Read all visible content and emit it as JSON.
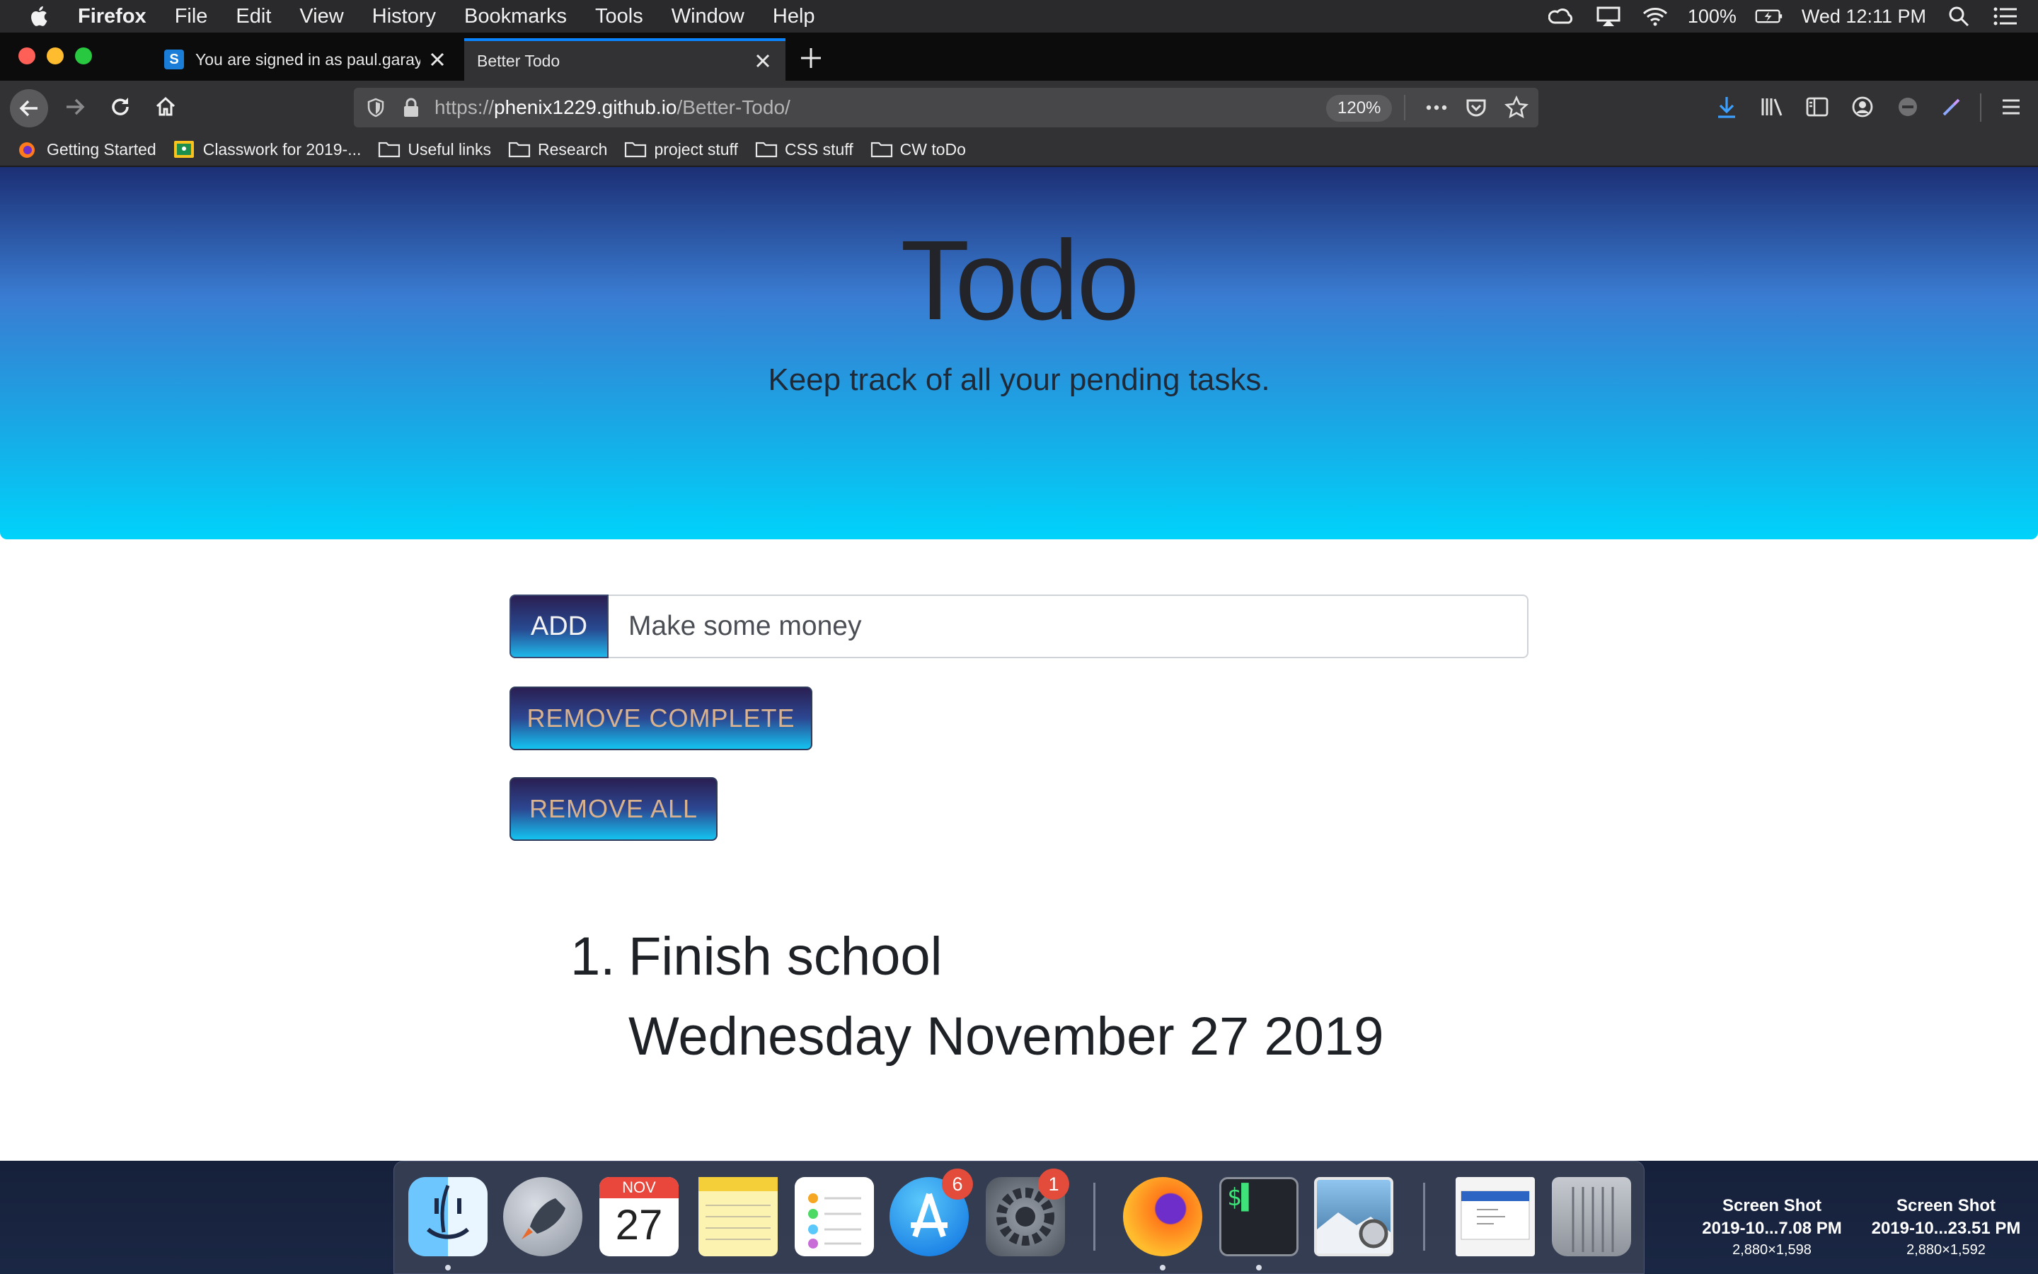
{
  "menubar": {
    "app_name": "Firefox",
    "menus": [
      "File",
      "Edit",
      "View",
      "History",
      "Bookmarks",
      "Tools",
      "Window",
      "Help"
    ],
    "battery": "100%",
    "clock": "Wed 12:11 PM",
    "status_icons": [
      "creative-cloud-icon",
      "airplay-icon",
      "wifi-icon",
      "battery-icon",
      "spotlight-icon",
      "notification-center-icon"
    ]
  },
  "tabs": [
    {
      "title": "You are signed in as paul.garay",
      "favicon": "S",
      "active": false
    },
    {
      "title": "Better Todo",
      "active": true
    }
  ],
  "address": {
    "protocol": "https://",
    "domain": "phenix1229.github.io",
    "path": "/Better-Todo/",
    "zoom": "120%"
  },
  "bookmarks": [
    "Getting Started",
    "Classwork for 2019-...",
    "Useful links",
    "Research",
    "project stuff",
    "CSS stuff",
    "CW toDo"
  ],
  "page": {
    "title": "Todo",
    "subtitle": "Keep track of all your pending tasks.",
    "add_label": "ADD",
    "input_value": "Make some money",
    "remove_complete_label": "REMOVE COMPLETE",
    "remove_all_label": "REMOVE ALL",
    "todos": [
      {
        "number": "1.",
        "text": "Finish school",
        "date": "Wednesday November 27 2019"
      }
    ]
  },
  "dock": {
    "apps": [
      "Finder",
      "Launchpad",
      "Calendar",
      "Notes",
      "Reminders",
      "App Store",
      "System Preferences",
      "Firefox",
      "Terminal",
      "Preview",
      "Screenshot",
      "Trash"
    ],
    "calendar_month": "NOV",
    "calendar_day": "27",
    "app_store_badge": "6",
    "system_prefs_badge": "1"
  },
  "desktop_files": [
    {
      "name": "Screen Shot",
      "detail": "2019-10...7.08 PM",
      "dims": "2,880×1,598"
    },
    {
      "name": "Screen Shot",
      "detail": "2019-10...23.51 PM",
      "dims": "2,880×1,592"
    }
  ],
  "colors": {
    "accent": "#0a84ff",
    "hero_top": "#1c2f74",
    "hero_bottom": "#00d3fb",
    "button_text": "#d8b28f"
  }
}
